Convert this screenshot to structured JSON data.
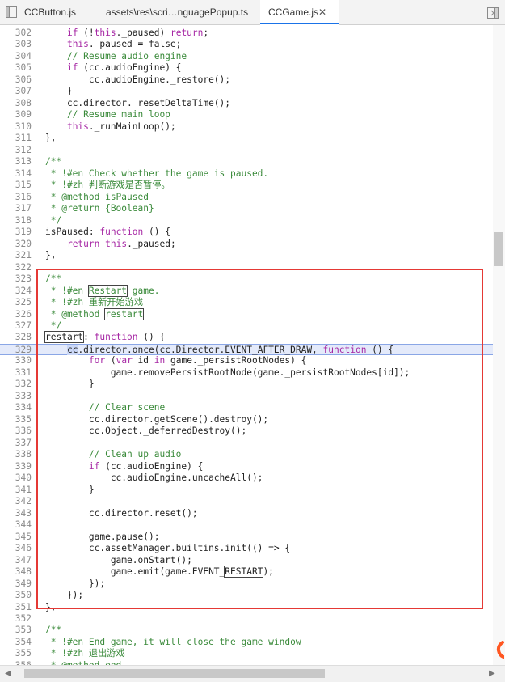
{
  "tabs": [
    {
      "label": "CCButton.js",
      "active": false
    },
    {
      "label": "assets\\res\\scri…nguagePopup.ts",
      "active": false
    },
    {
      "label": "CCGame.js",
      "active": true
    }
  ],
  "close_glyph": "✕",
  "lines": [
    {
      "n": "302",
      "t": "    if (!this._paused) return;"
    },
    {
      "n": "303",
      "t": "    this._paused = false;"
    },
    {
      "n": "304",
      "t": "    // Resume audio engine"
    },
    {
      "n": "305",
      "t": "    if (cc.audioEngine) {"
    },
    {
      "n": "306",
      "t": "        cc.audioEngine._restore();"
    },
    {
      "n": "307",
      "t": "    }"
    },
    {
      "n": "308",
      "t": "    cc.director._resetDeltaTime();"
    },
    {
      "n": "309",
      "t": "    // Resume main loop"
    },
    {
      "n": "310",
      "t": "    this._runMainLoop();"
    },
    {
      "n": "311",
      "t": "},"
    },
    {
      "n": "312",
      "t": ""
    },
    {
      "n": "313",
      "t": "/**"
    },
    {
      "n": "314",
      "t": " * !#en Check whether the game is paused."
    },
    {
      "n": "315",
      "t": " * !#zh 判断游戏是否暂停。"
    },
    {
      "n": "316",
      "t": " * @method isPaused"
    },
    {
      "n": "317",
      "t": " * @return {Boolean}"
    },
    {
      "n": "318",
      "t": " */"
    },
    {
      "n": "319",
      "t": "isPaused: function () {"
    },
    {
      "n": "320",
      "t": "    return this._paused;"
    },
    {
      "n": "321",
      "t": "},"
    },
    {
      "n": "322",
      "t": ""
    },
    {
      "n": "323",
      "t": "/**"
    },
    {
      "n": "324",
      "t": " * !#en Restart game."
    },
    {
      "n": "325",
      "t": " * !#zh 重新开始游戏"
    },
    {
      "n": "326",
      "t": " * @method restart"
    },
    {
      "n": "327",
      "t": " */"
    },
    {
      "n": "328",
      "t": "restart: function () {"
    },
    {
      "n": "329",
      "t": "    cc.director.once(cc.Director.EVENT_AFTER_DRAW, function () {"
    },
    {
      "n": "330",
      "t": "        for (var id in game._persistRootNodes) {"
    },
    {
      "n": "331",
      "t": "            game.removePersistRootNode(game._persistRootNodes[id]);"
    },
    {
      "n": "332",
      "t": "        }"
    },
    {
      "n": "333",
      "t": ""
    },
    {
      "n": "334",
      "t": "        // Clear scene"
    },
    {
      "n": "335",
      "t": "        cc.director.getScene().destroy();"
    },
    {
      "n": "336",
      "t": "        cc.Object._deferredDestroy();"
    },
    {
      "n": "337",
      "t": ""
    },
    {
      "n": "338",
      "t": "        // Clean up audio"
    },
    {
      "n": "339",
      "t": "        if (cc.audioEngine) {"
    },
    {
      "n": "340",
      "t": "            cc.audioEngine.uncacheAll();"
    },
    {
      "n": "341",
      "t": "        }"
    },
    {
      "n": "342",
      "t": ""
    },
    {
      "n": "343",
      "t": "        cc.director.reset();"
    },
    {
      "n": "344",
      "t": ""
    },
    {
      "n": "345",
      "t": "        game.pause();"
    },
    {
      "n": "346",
      "t": "        cc.assetManager.builtins.init(() => {"
    },
    {
      "n": "347",
      "t": "            game.onStart();"
    },
    {
      "n": "348",
      "t": "            game.emit(game.EVENT_RESTART);"
    },
    {
      "n": "349",
      "t": "        });"
    },
    {
      "n": "350",
      "t": "    });"
    },
    {
      "n": "351",
      "t": "},"
    },
    {
      "n": "352",
      "t": ""
    },
    {
      "n": "353",
      "t": "/**"
    },
    {
      "n": "354",
      "t": " * !#en End game, it will close the game window"
    },
    {
      "n": "355",
      "t": " * !#zh 退出游戏"
    },
    {
      "n": "356",
      "t": " * @method end"
    }
  ],
  "current_line": "329",
  "highlight_word": "restart",
  "colors": {
    "keyword": "#a626a4",
    "comment": "#3a8a3a",
    "text": "#222222",
    "line_number": "#8a8a8a",
    "red_box": "#e53935",
    "current_line_bg": "#e1e8fa",
    "tab_active_underline": "#1a73e8"
  },
  "icons": {
    "left": "panel-left-icon",
    "right": "panel-right-icon",
    "close": "close-icon",
    "marker": "breakpoint-marker-icon"
  }
}
